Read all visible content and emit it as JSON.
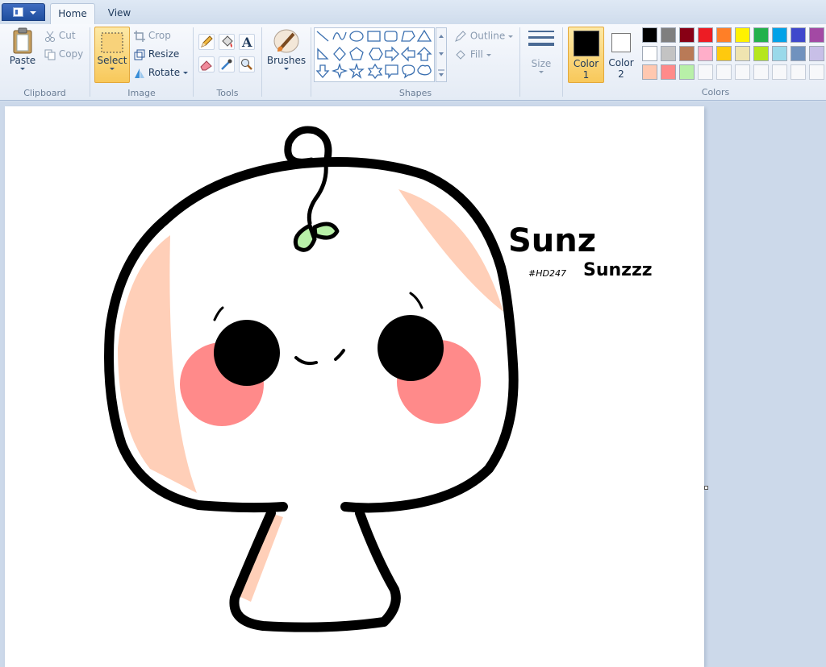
{
  "tabs": {
    "home": "Home",
    "view": "View"
  },
  "clipboard": {
    "paste": "Paste",
    "cut": "Cut",
    "copy": "Copy",
    "label": "Clipboard"
  },
  "image": {
    "select": "Select",
    "crop": "Crop",
    "resize": "Resize",
    "rotate": "Rotate",
    "label": "Image"
  },
  "tools": {
    "label": "Tools"
  },
  "brushes": {
    "label": "Brushes"
  },
  "shapes": {
    "outline": "Outline",
    "fill": "Fill",
    "label": "Shapes"
  },
  "size": {
    "label": "Size"
  },
  "color1": {
    "label": "Color",
    "num": "1",
    "value": "#000000"
  },
  "color2": {
    "label": "Color",
    "num": "2",
    "value": "#ffffff"
  },
  "colors": {
    "label": "Colors",
    "row1": [
      "#000000",
      "#7f7f7f",
      "#880015",
      "#ed1c24",
      "#ff7f27",
      "#fff200",
      "#22b14c",
      "#00a2e8",
      "#3f48cc",
      "#a349a4"
    ],
    "row2": [
      "#ffffff",
      "#c3c3c3",
      "#b97a57",
      "#ffaec9",
      "#ffc90e",
      "#efe4b0",
      "#b5e61d",
      "#99d9ea",
      "#7092be",
      "#c8bfe7"
    ],
    "row3": [
      "#ffc8b0",
      "#ff8a8a",
      "#b8f0a8"
    ]
  },
  "drawing": {
    "signature_main": "Sunz",
    "signature_tag": "#HD247",
    "signature_alt": "Sunzzz",
    "outline_color": "#000000",
    "blush_color": "#ff8a8a",
    "shade_color": "#ffcfb8",
    "sprout_color": "#b8f0a8"
  }
}
